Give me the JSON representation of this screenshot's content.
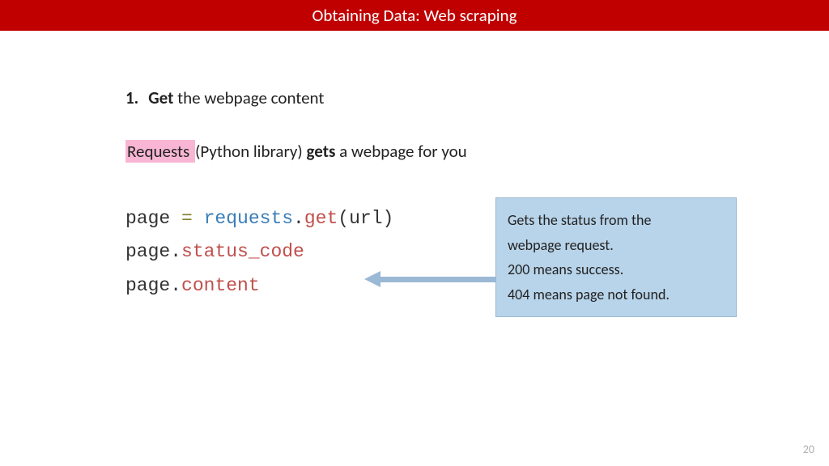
{
  "header": {
    "title": "Obtaining Data: Web scraping"
  },
  "bullet": {
    "num": "1.",
    "bold": "Get",
    "rest": " the webpage content"
  },
  "desc": {
    "highlight": "Requests ",
    "mid1": "(Python library) ",
    "bold": "gets",
    "mid2": " a webpage for you"
  },
  "code": {
    "l1_a": "page ",
    "l1_b": "= ",
    "l1_c": "requests",
    "l1_d": ".",
    "l1_e": "get",
    "l1_f": "(url)",
    "l2_a": "page",
    "l2_b": ".",
    "l2_c": "status_code",
    "l3_a": "page",
    "l3_b": ".",
    "l3_c": "content"
  },
  "callout": {
    "line1": "Gets the status from the",
    "line2": "webpage request.",
    "line3": "200 means success.",
    "line4": "404 means page not found."
  },
  "page_number": "20"
}
